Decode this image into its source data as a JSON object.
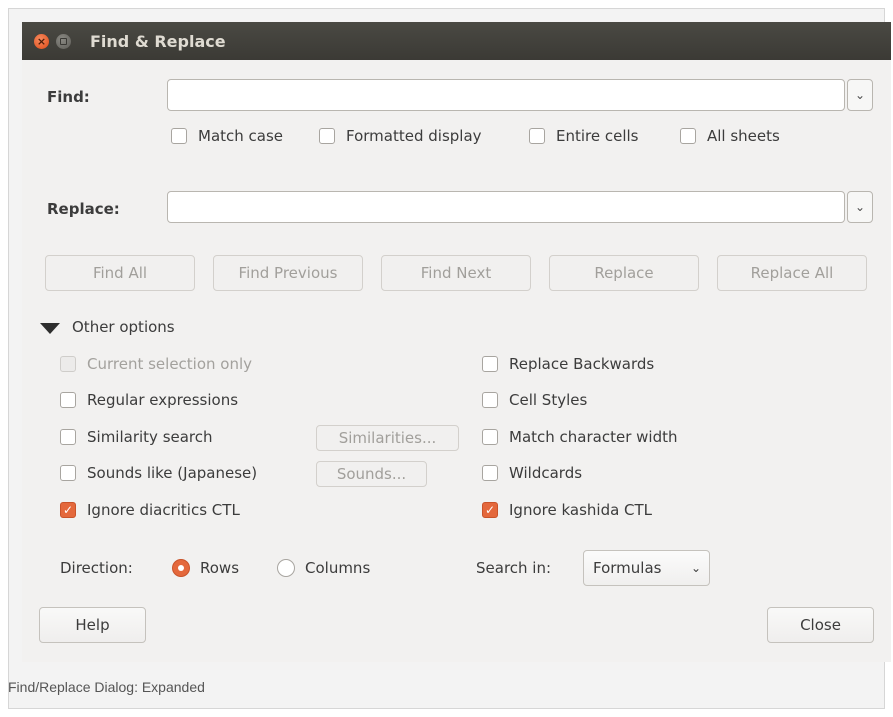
{
  "window": {
    "title": "Find & Replace",
    "close_glyph": "×"
  },
  "find": {
    "label": "Find:",
    "value": "",
    "dropdown_glyph": "⌄"
  },
  "find_options": [
    {
      "label": "Match case",
      "checked": false
    },
    {
      "label": "Formatted display",
      "checked": false
    },
    {
      "label": "Entire cells",
      "checked": false
    },
    {
      "label": "All sheets",
      "checked": false
    }
  ],
  "replace": {
    "label": "Replace:",
    "value": "",
    "dropdown_glyph": "⌄"
  },
  "actions": {
    "find_all": "Find All",
    "find_previous": "Find Previous",
    "find_next": "Find Next",
    "replace": "Replace",
    "replace_all": "Replace All"
  },
  "other_options": {
    "label": "Other options",
    "expanded": true,
    "left": [
      {
        "label": "Current selection only",
        "checked": false,
        "disabled": true
      },
      {
        "label": "Regular expressions",
        "checked": false
      },
      {
        "label": "Similarity search",
        "checked": false
      },
      {
        "label": "Sounds like (Japanese)",
        "checked": false
      },
      {
        "label": "Ignore diacritics CTL",
        "checked": true
      }
    ],
    "similarities_button": "Similarities...",
    "sounds_button": "Sounds...",
    "right": [
      {
        "label": "Replace Backwards",
        "checked": false
      },
      {
        "label": "Cell Styles",
        "checked": false
      },
      {
        "label": "Match character width",
        "checked": false
      },
      {
        "label": "Wildcards",
        "checked": false
      },
      {
        "label": "Ignore kashida CTL",
        "checked": true
      }
    ]
  },
  "direction": {
    "label": "Direction:",
    "options": [
      {
        "label": "Rows",
        "selected": true
      },
      {
        "label": "Columns",
        "selected": false
      }
    ]
  },
  "search_in": {
    "label": "Search in:",
    "value": "Formulas",
    "chevron": "⌄"
  },
  "footer": {
    "help": "Help",
    "close": "Close"
  },
  "caption": "Find/Replace Dialog: Expanded",
  "colors": {
    "accent": "#e4683c",
    "titlebar": "#3c3b37",
    "dialog_bg": "#f2f1f0"
  },
  "check_glyph": "✓"
}
